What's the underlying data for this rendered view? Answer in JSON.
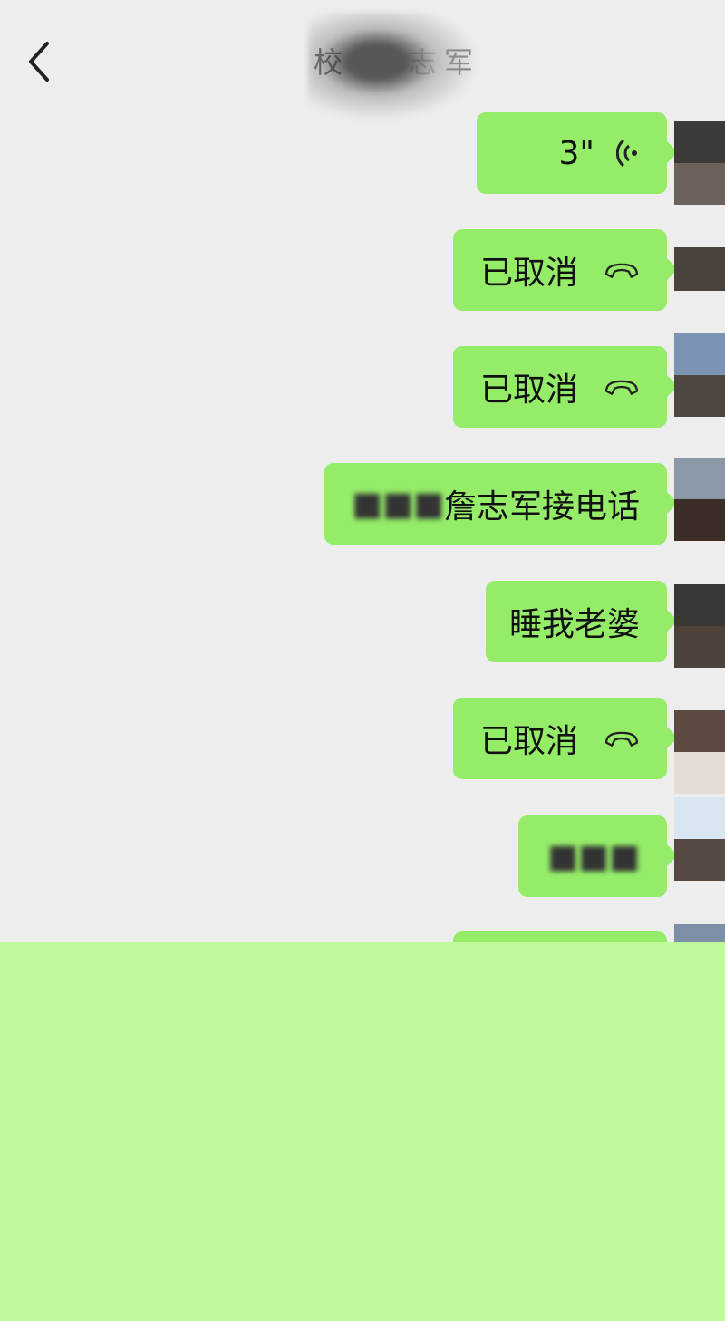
{
  "header": {
    "back_icon": "chevron-left-icon",
    "title_visible_parts": [
      "校",
      "志",
      "军"
    ]
  },
  "messages": [
    {
      "type": "voice",
      "text": "3\"",
      "icon": "voice-wave-icon"
    },
    {
      "type": "call",
      "text": "已取消",
      "icon": "phone-hangup-icon"
    },
    {
      "type": "call",
      "text": "已取消",
      "icon": "phone-hangup-icon"
    },
    {
      "type": "text",
      "text": "詹志军接电话",
      "redacted_prefix": true
    },
    {
      "type": "text",
      "text": "睡我老婆"
    },
    {
      "type": "call",
      "text": "已取消",
      "icon": "phone-hangup-icon"
    },
    {
      "type": "text",
      "text": "",
      "redacted": true
    }
  ],
  "colors": {
    "background": "#ededed",
    "bubble": "#95ec69",
    "overlay": "#bef89a"
  }
}
